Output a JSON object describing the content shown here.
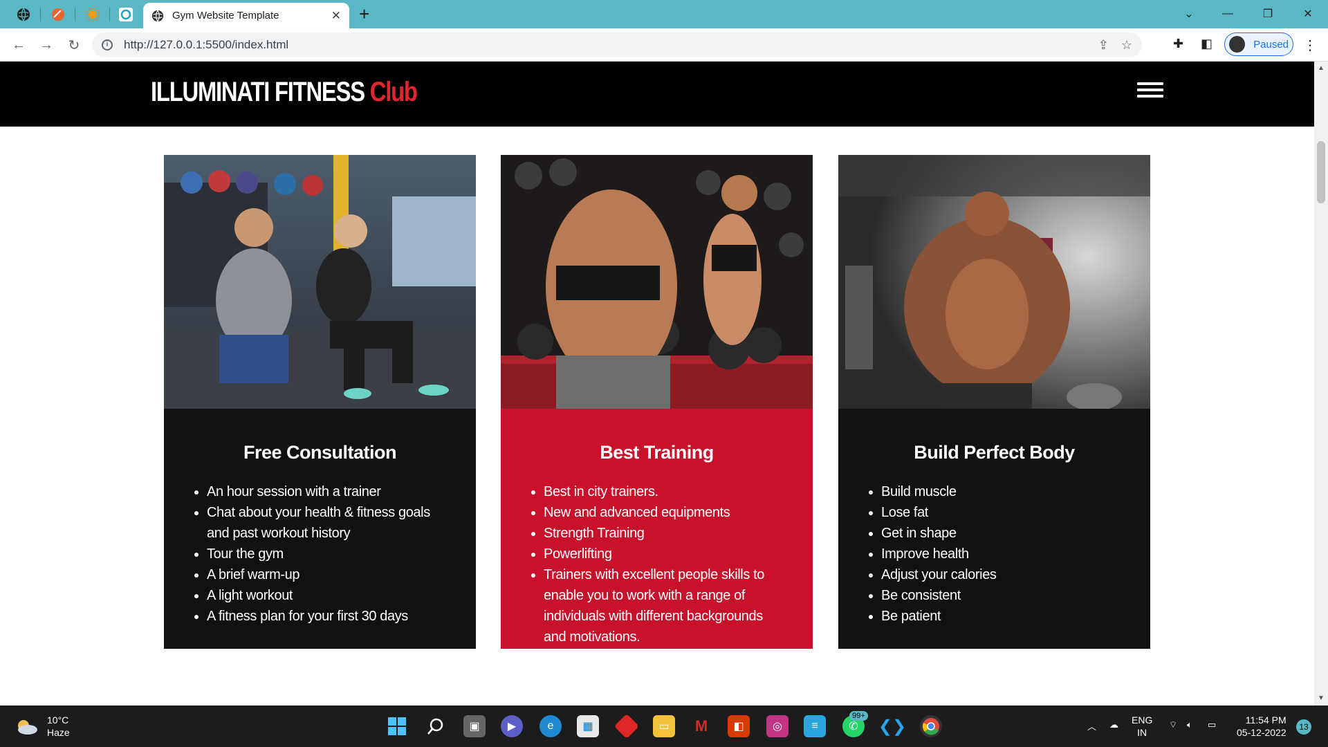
{
  "browser": {
    "tab_title": "Gym Website Template",
    "url": "http://127.0.0.1:5500/index.html",
    "profile_status": "Paused"
  },
  "site": {
    "logo_main": "ILLUMINATI FITNESS",
    "logo_accent": "Club"
  },
  "cards": [
    {
      "title": "Free Consultation",
      "items": [
        "An hour session with a trainer",
        "Chat about your health & fitness goals and past workout history",
        "Tour the gym",
        "A brief warm-up",
        "A light workout",
        "A fitness plan for your first 30 days"
      ]
    },
    {
      "title": "Best Training",
      "items": [
        "Best in city trainers.",
        "New and advanced equipments",
        "Strength Training",
        "Powerlifting",
        "Trainers with excellent people skills to enable you to work with a range of individuals with different backgrounds and motivations."
      ]
    },
    {
      "title": "Build Perfect Body",
      "items": [
        "Build muscle",
        "Lose fat",
        "Get in shape",
        "Improve health",
        "Adjust your calories",
        "Be consistent",
        "Be patient"
      ]
    }
  ],
  "taskbar": {
    "weather_temp": "10°C",
    "weather_desc": "Haze",
    "whatsapp_badge": "99+",
    "lang_line1": "ENG",
    "lang_line2": "IN",
    "time": "11:54 PM",
    "date": "05-12-2022",
    "notifications": "13"
  },
  "colors": {
    "accent_red": "#c8112a",
    "card_dark": "#111111",
    "chrome_teal": "#5ab8c4"
  }
}
